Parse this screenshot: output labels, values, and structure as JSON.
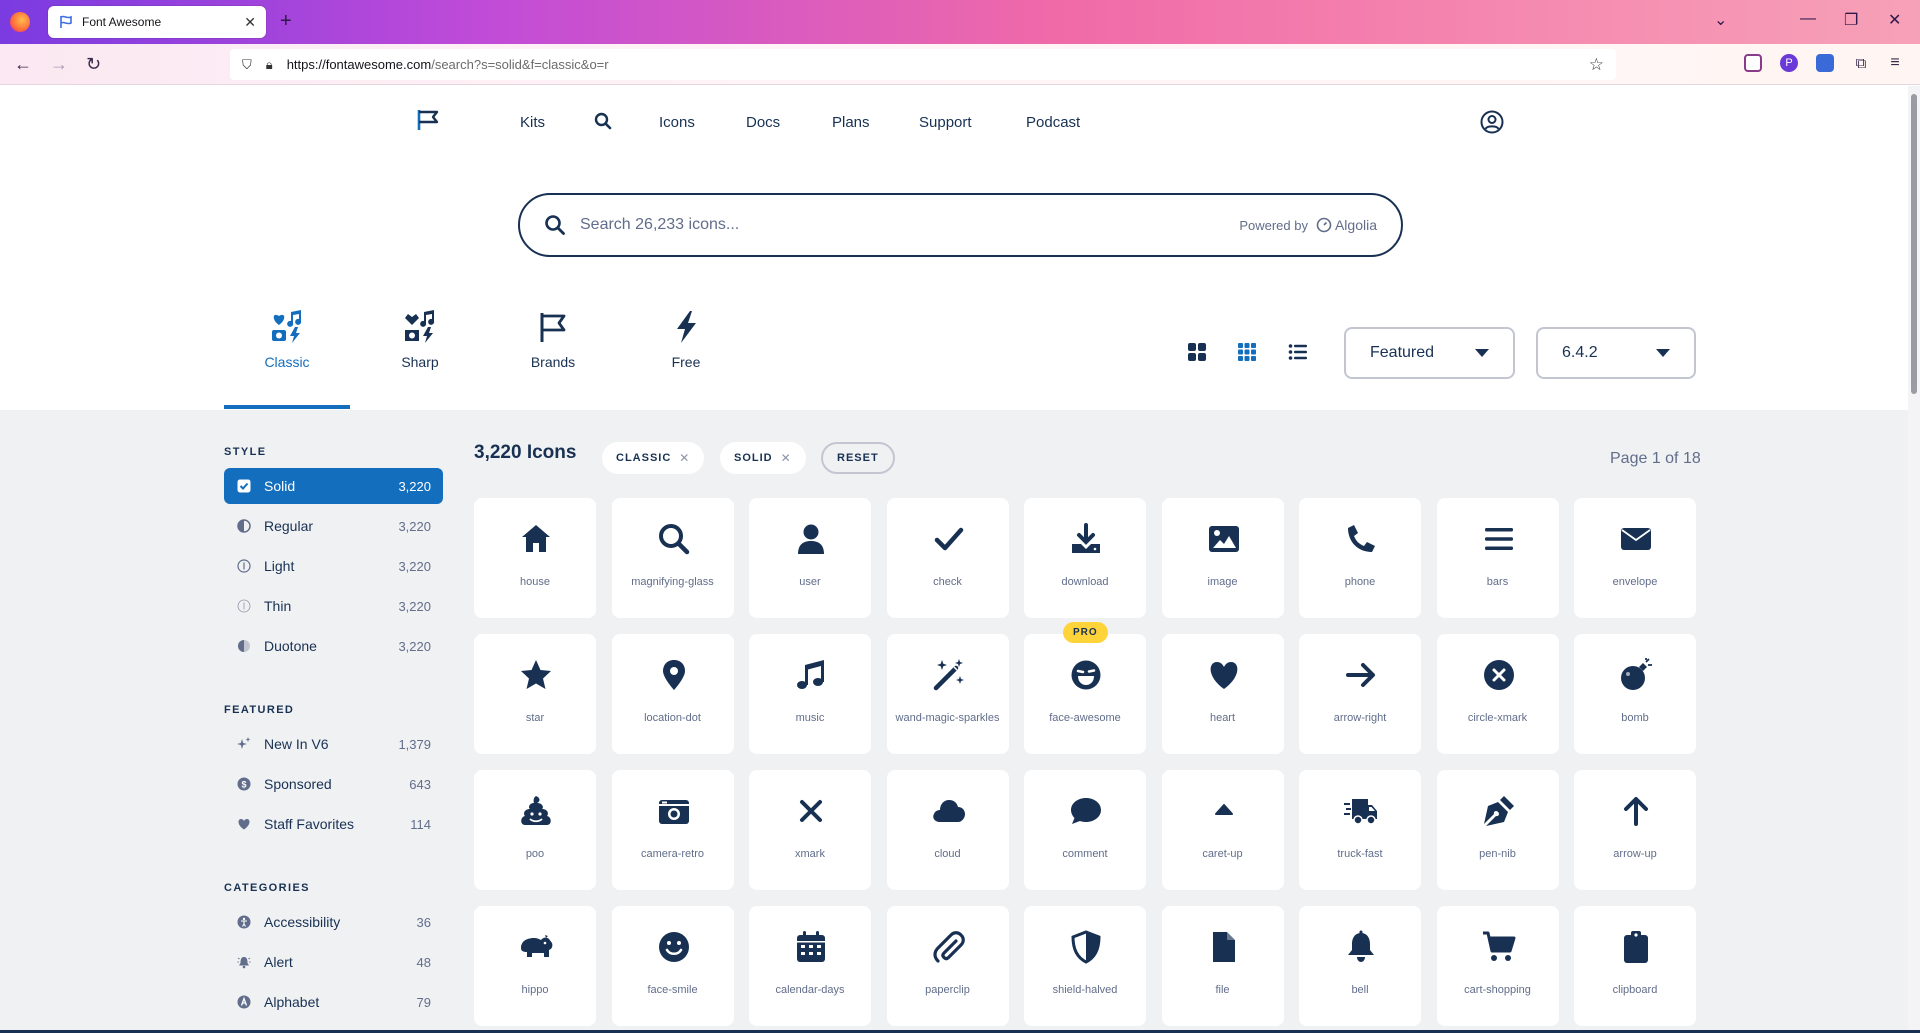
{
  "browser": {
    "tab_title": "Font Awesome",
    "url_host": "https://fontawesome.com",
    "url_path": "/search?s=solid&f=classic&o=r"
  },
  "nav": {
    "items": [
      "Kits",
      "Icons",
      "Docs",
      "Plans",
      "Support",
      "Podcast"
    ]
  },
  "search": {
    "placeholder": "Search 26,233 icons...",
    "powered_by": "Powered by",
    "provider": "Algolia"
  },
  "families": [
    {
      "label": "Classic",
      "active": true
    },
    {
      "label": "Sharp",
      "active": false
    },
    {
      "label": "Brands",
      "active": false
    },
    {
      "label": "Free",
      "active": false
    }
  ],
  "sort_select": "Featured",
  "version_select": "6.4.2",
  "sidebar": {
    "style_heading": "STYLE",
    "style_items": [
      {
        "label": "Solid",
        "count": "3,220",
        "icon": "checkbox-checked-icon",
        "active": true
      },
      {
        "label": "Regular",
        "count": "3,220",
        "icon": "circle-half-icon"
      },
      {
        "label": "Light",
        "count": "3,220",
        "icon": "circle-info-icon"
      },
      {
        "label": "Thin",
        "count": "3,220",
        "icon": "circle-info-icon"
      },
      {
        "label": "Duotone",
        "count": "3,220",
        "icon": "circle-half-icon"
      }
    ],
    "featured_heading": "FEATURED",
    "featured_items": [
      {
        "label": "New In V6",
        "count": "1,379",
        "icon": "sparkles-icon"
      },
      {
        "label": "Sponsored",
        "count": "643",
        "icon": "dollar-circle-icon"
      },
      {
        "label": "Staff Favorites",
        "count": "114",
        "icon": "heart-icon"
      }
    ],
    "categories_heading": "CATEGORIES",
    "category_items": [
      {
        "label": "Accessibility",
        "count": "36",
        "icon": "accessibility-icon"
      },
      {
        "label": "Alert",
        "count": "48",
        "icon": "alert-bell-icon"
      },
      {
        "label": "Alphabet",
        "count": "79",
        "icon": "alphabet-a-icon"
      }
    ]
  },
  "results": {
    "count_label": "3,220 Icons",
    "chips": [
      "CLASSIC",
      "SOLID"
    ],
    "reset_label": "RESET",
    "page_info": "Page 1 of 18"
  },
  "icons": [
    {
      "name": "house"
    },
    {
      "name": "magnifying-glass"
    },
    {
      "name": "user"
    },
    {
      "name": "check"
    },
    {
      "name": "download"
    },
    {
      "name": "image"
    },
    {
      "name": "phone"
    },
    {
      "name": "bars"
    },
    {
      "name": "envelope"
    },
    {
      "name": "star"
    },
    {
      "name": "location-dot"
    },
    {
      "name": "music"
    },
    {
      "name": "wand-magic-sparkles"
    },
    {
      "name": "face-awesome",
      "badge": "PRO"
    },
    {
      "name": "heart"
    },
    {
      "name": "arrow-right"
    },
    {
      "name": "circle-xmark"
    },
    {
      "name": "bomb"
    },
    {
      "name": "poo"
    },
    {
      "name": "camera-retro"
    },
    {
      "name": "xmark"
    },
    {
      "name": "cloud"
    },
    {
      "name": "comment"
    },
    {
      "name": "caret-up"
    },
    {
      "name": "truck-fast"
    },
    {
      "name": "pen-nib"
    },
    {
      "name": "arrow-up"
    },
    {
      "name": "hippo"
    },
    {
      "name": "face-smile"
    },
    {
      "name": "calendar-days"
    },
    {
      "name": "paperclip"
    },
    {
      "name": "shield-halved"
    },
    {
      "name": "file"
    },
    {
      "name": "bell"
    },
    {
      "name": "cart-shopping"
    },
    {
      "name": "clipboard"
    }
  ],
  "colors": {
    "navy": "#183153",
    "blue": "#146ebe",
    "gray_bg": "#f0f1f3",
    "pro_yellow": "#ffd43b"
  }
}
